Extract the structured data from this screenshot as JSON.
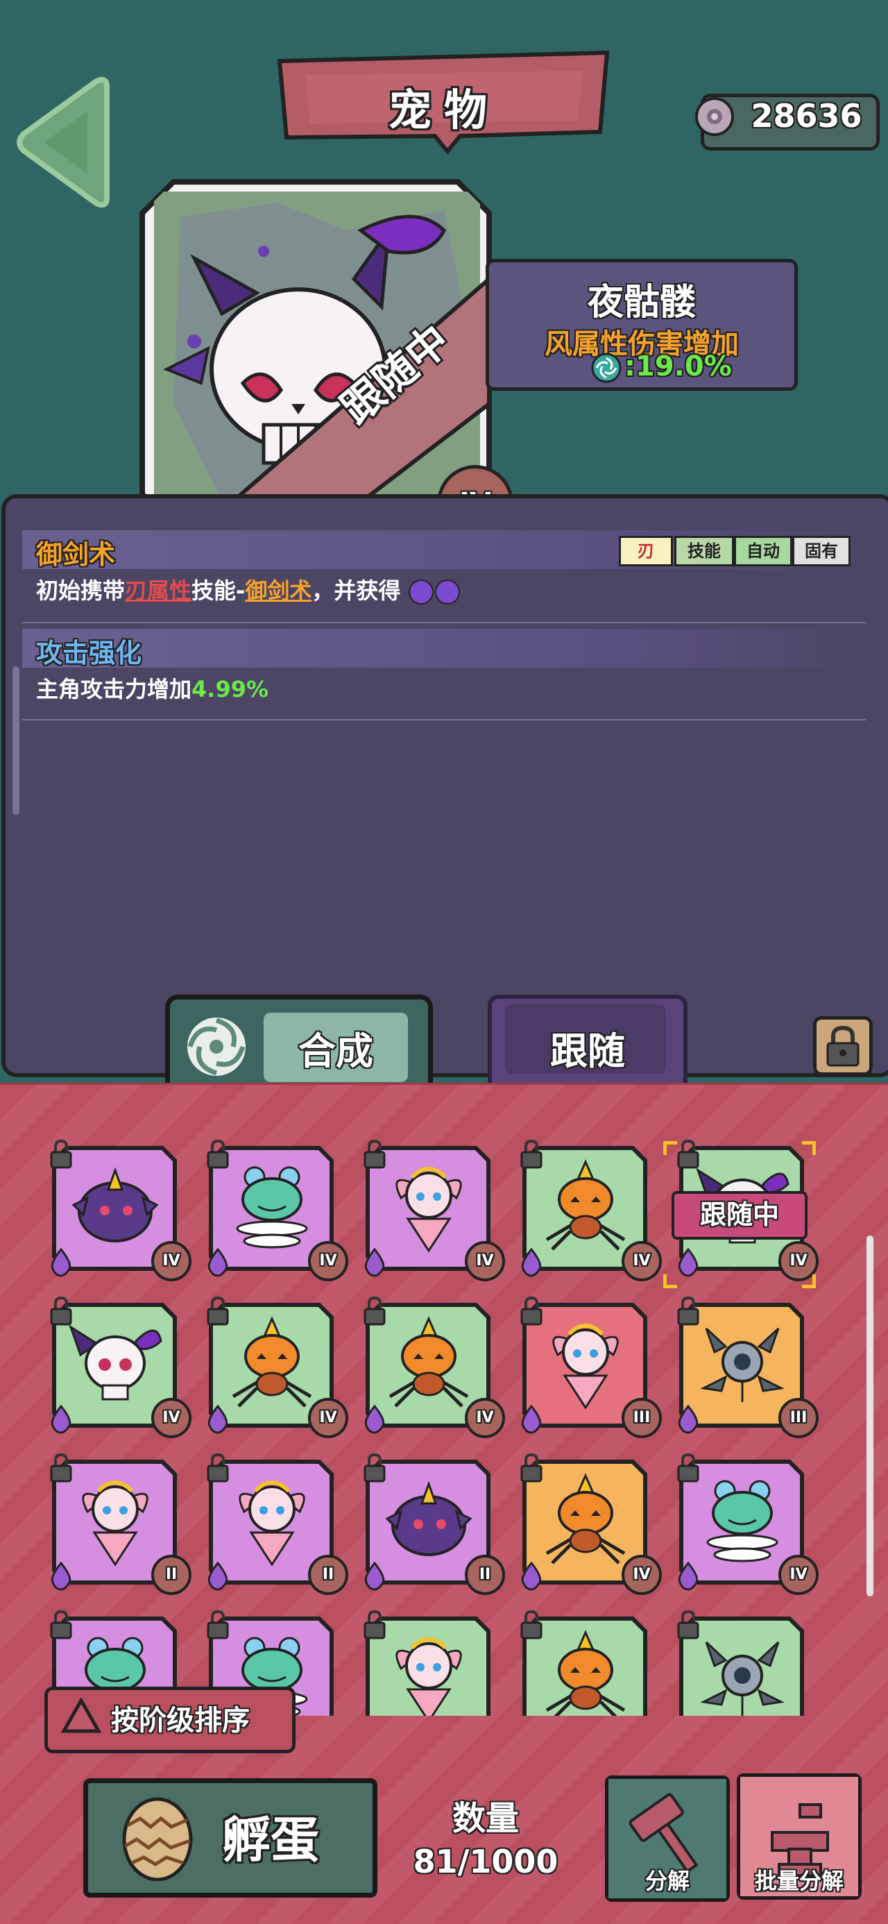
{
  "header": {
    "title": "宠物",
    "currency_value": "28636",
    "back_icon": "triangle-left-icon",
    "currency_icon": "gear-coin-icon"
  },
  "selected_pet": {
    "name": "夜骷髅",
    "attribute": "风属性伤害增加",
    "attribute_value": ":19.0%",
    "status_ribbon": "跟随中",
    "tier": "IV"
  },
  "skills": [
    {
      "name": "御剑术",
      "desc_prefix": "初始携带",
      "desc_highlight1": "刃属性",
      "desc_mid": "技能-",
      "desc_highlight2": "御剑术",
      "desc_suffix": "，并获得",
      "tags": [
        "刃",
        "技能",
        "自动",
        "固有"
      ]
    },
    {
      "name": "攻击强化",
      "desc_prefix": "主角攻击力增加",
      "desc_value": "4.99%"
    }
  ],
  "actions": {
    "synthesize": "合成",
    "follow": "跟随"
  },
  "grid": {
    "follow_tag": "跟随中",
    "cells": [
      {
        "pet": "purple-blob",
        "bg": "#d68fe0",
        "tier": "IV"
      },
      {
        "pet": "spring-goblin",
        "bg": "#d68fe0",
        "tier": "IV"
      },
      {
        "pet": "flower-fairy",
        "bg": "#d68fe0",
        "tier": "IV"
      },
      {
        "pet": "pumpkin-spider",
        "bg": "#a7d9a9",
        "tier": "IV"
      },
      {
        "pet": "night-skull",
        "bg": "#a7d9a9",
        "tier": "IV"
      },
      {
        "pet": "night-skull",
        "bg": "#a7d9a9",
        "tier": "IV"
      },
      {
        "pet": "pumpkin-spider",
        "bg": "#a7d9a9",
        "tier": "IV"
      },
      {
        "pet": "pumpkin-spider",
        "bg": "#a7d9a9",
        "tier": "IV"
      },
      {
        "pet": "flower-fairy",
        "bg": "#e6717e",
        "tier": "III"
      },
      {
        "pet": "orb-drone",
        "bg": "#f5b55e",
        "tier": "III"
      },
      {
        "pet": "flower-fairy",
        "bg": "#d68fe0",
        "tier": "II"
      },
      {
        "pet": "flower-fairy",
        "bg": "#d68fe0",
        "tier": "II"
      },
      {
        "pet": "purple-blob",
        "bg": "#d68fe0",
        "tier": "II"
      },
      {
        "pet": "pumpkin-spider",
        "bg": "#f5b55e",
        "tier": "IV"
      },
      {
        "pet": "spring-goblin",
        "bg": "#d68fe0",
        "tier": "IV"
      },
      {
        "pet": "spring-goblin",
        "bg": "#d68fe0",
        "tier": ""
      },
      {
        "pet": "spring-goblin",
        "bg": "#d68fe0",
        "tier": ""
      },
      {
        "pet": "flower-fairy",
        "bg": "#a7d9a9",
        "tier": ""
      },
      {
        "pet": "pumpkin-spider",
        "bg": "#a7d9a9",
        "tier": ""
      },
      {
        "pet": "orb-drone",
        "bg": "#a7d9a9",
        "tier": ""
      }
    ]
  },
  "sort_label": "按阶级排序",
  "footer": {
    "hatch": "孵蛋",
    "count_title": "数量",
    "count_value": "81/1000",
    "decompose": "分解",
    "batch_decompose": "批量分解"
  }
}
